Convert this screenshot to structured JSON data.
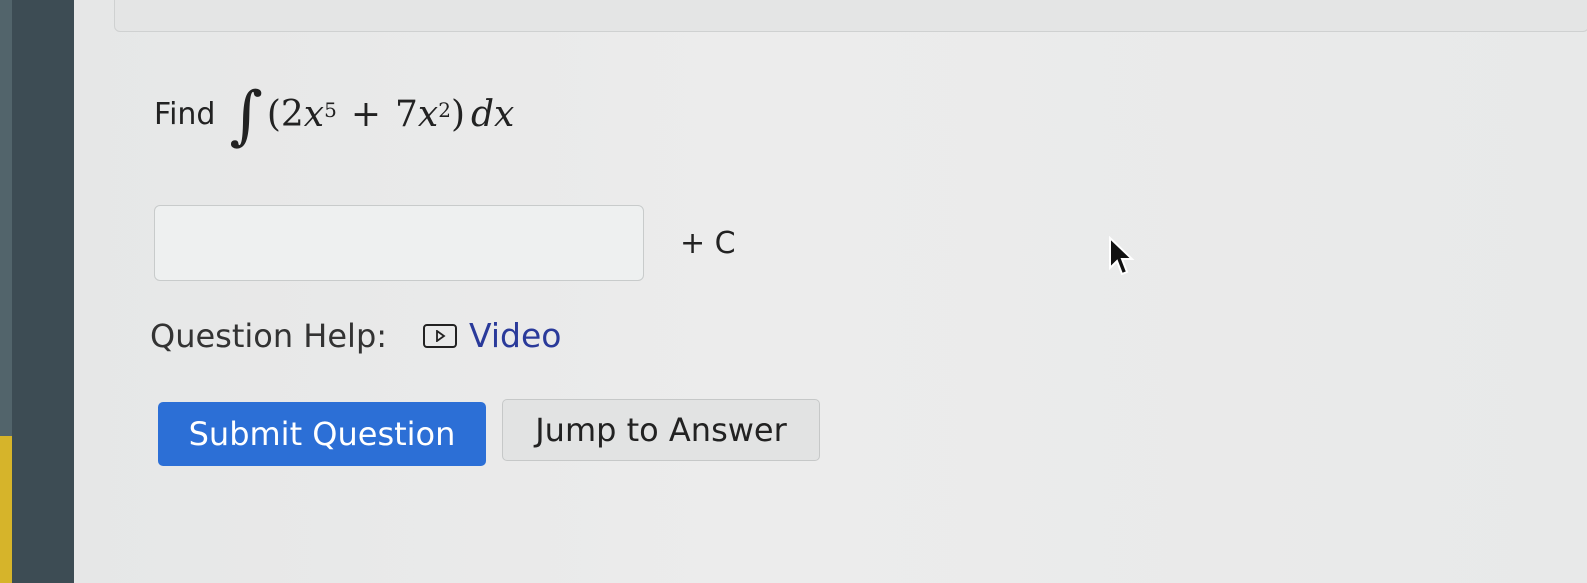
{
  "question": {
    "prefix": "Find",
    "integral_sign": "∫",
    "open_paren": "(",
    "coef1": "2",
    "var1": "x",
    "exp1": "5",
    "plus": "+",
    "coef2": "7",
    "var2": "x",
    "exp2": "2",
    "close_paren": ")",
    "differential": "dx"
  },
  "answer": {
    "value": "",
    "constant_label": "+ C"
  },
  "help": {
    "label": "Question Help:",
    "video_icon": "play-video-icon",
    "video_label": "Video"
  },
  "buttons": {
    "submit_label": "Submit Question",
    "jump_label": "Jump to Answer"
  },
  "colors": {
    "submit_bg": "#2c6fd6",
    "link": "#2a3a9a",
    "bezel": "#3d4c54"
  }
}
